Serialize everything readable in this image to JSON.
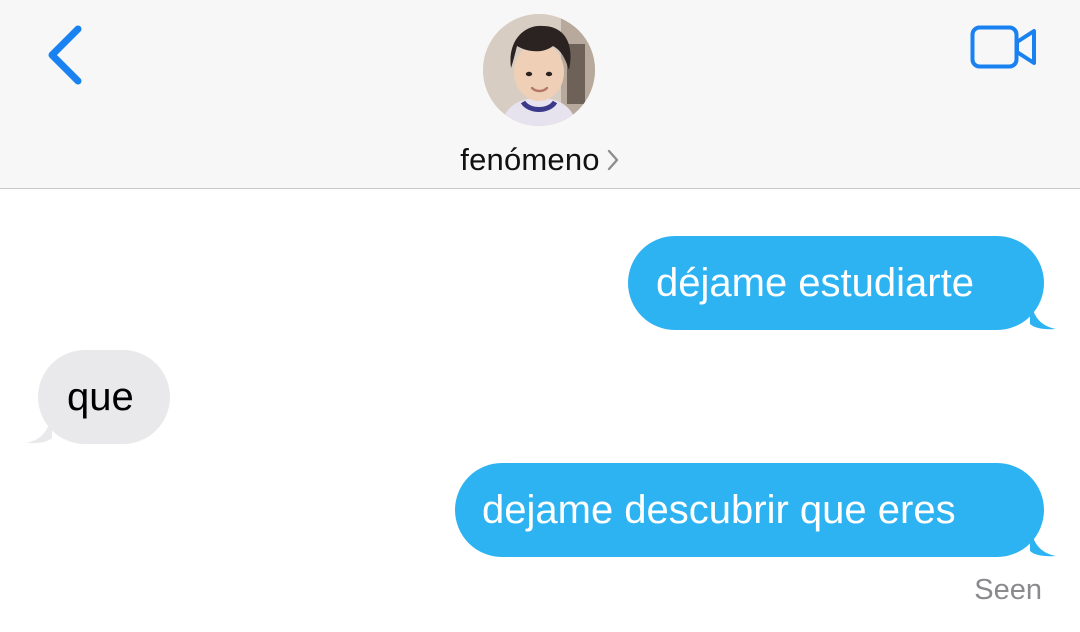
{
  "header": {
    "contact_name": "fenómeno",
    "icons": {
      "back": "chevron-left-icon",
      "video": "video-camera-icon",
      "name_chevron": "chevron-right-icon"
    },
    "accent_color": "#1a82f0"
  },
  "messages": [
    {
      "direction": "outgoing",
      "text": "déjame estudiarte"
    },
    {
      "direction": "incoming",
      "text": "que"
    },
    {
      "direction": "outgoing",
      "text": "dejame descubrir que eres"
    }
  ],
  "status": {
    "seen": "Seen"
  },
  "colors": {
    "outgoing_bubble": "#2eb3f2",
    "incoming_bubble": "#e9e9eb",
    "header_background": "#f7f7f7"
  }
}
